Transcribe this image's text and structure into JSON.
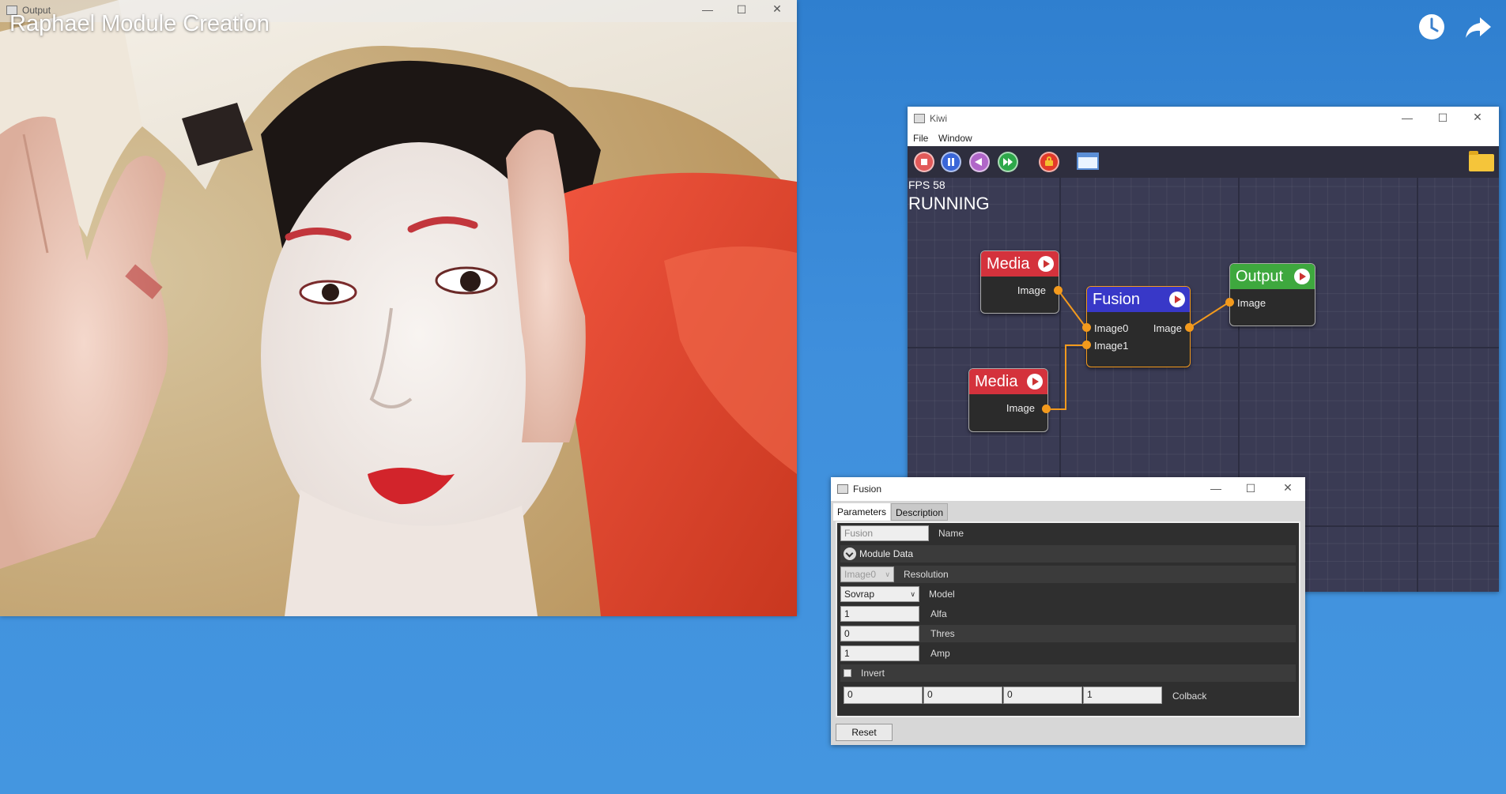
{
  "video": {
    "title": "Raphael Module Creation",
    "watch_later_icon": "clock-icon",
    "share_icon": "share-arrow-icon"
  },
  "output_window": {
    "title": "Output",
    "image_description_icon": "video-frame"
  },
  "kiwi_window": {
    "title": "Kiwi",
    "menu": [
      "File",
      "Window"
    ],
    "toolbar": {
      "stop_icon": "stop-icon",
      "pause_icon": "pause-icon",
      "rewind_icon": "rewind-icon",
      "forward_icon": "fast-forward-icon",
      "lock_icon": "lock-icon",
      "window_icon": "window-icon",
      "folder_icon": "folder-icon"
    },
    "fps": "FPS 58",
    "status": "RUNNING",
    "nodes": {
      "media1": {
        "title": "Media",
        "output": "Image",
        "color": "#d4323c"
      },
      "media2": {
        "title": "Media",
        "output": "Image",
        "color": "#d4323c"
      },
      "fusion": {
        "title": "Fusion",
        "inputs": [
          "Image0",
          "Image1"
        ],
        "output": "Image",
        "color": "#3838c8"
      },
      "output": {
        "title": "Output",
        "input": "Image",
        "color": "#3ea83e"
      }
    },
    "link_color": "#f39a1d"
  },
  "fusion_window": {
    "title": "Fusion",
    "tabs": [
      "Parameters",
      "Description"
    ],
    "name_value": "Fusion",
    "name_label": "Name",
    "module_data_label": "Module Data",
    "resolution_value": "Image0",
    "resolution_label": "Resolution",
    "model_value": "Sovrap",
    "model_label": "Model",
    "alfa_value": "1",
    "alfa_label": "Alfa",
    "thres_value": "0",
    "thres_label": "Thres",
    "amp_value": "1",
    "amp_label": "Amp",
    "invert_label": "Invert",
    "colback_values": [
      "0",
      "0",
      "0",
      "1"
    ],
    "colback_label": "Colback",
    "reset_label": "Reset"
  }
}
